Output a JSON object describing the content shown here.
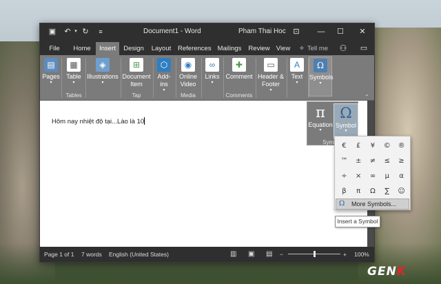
{
  "window": {
    "title": "Document1  -  Word",
    "user": "Pham Thai Hoc"
  },
  "tabs": [
    {
      "label": "File"
    },
    {
      "label": "Home"
    },
    {
      "label": "Insert"
    },
    {
      "label": "Design"
    },
    {
      "label": "Layout"
    },
    {
      "label": "References"
    },
    {
      "label": "Mailings"
    },
    {
      "label": "Review"
    },
    {
      "label": "View"
    },
    {
      "label": "Tell me"
    }
  ],
  "ribbon": {
    "pages": "Pages",
    "table": "Table",
    "illustrations": "Illustrations",
    "document_item_1": "Document",
    "document_item_2": "Item",
    "addins_1": "Add-",
    "addins_2": "ins",
    "online_video_1": "Online",
    "online_video_2": "Video",
    "links": "Links",
    "comment": "Comment",
    "header_footer_1": "Header &",
    "header_footer_2": "Footer",
    "text": "Text",
    "symbols": "Symbols",
    "groups": {
      "tables": "Tables",
      "tap": "Tap",
      "media": "Media",
      "comments": "Comments"
    }
  },
  "document": {
    "text": "Hôm nay nhiệt độ tại...Lào là 10"
  },
  "symbols_panel": {
    "equation": "Equation",
    "symbol": "Symbol",
    "group_label": "Symbols"
  },
  "symbol_grid": [
    "€",
    "£",
    "¥",
    "©",
    "®",
    "™",
    "±",
    "≠",
    "≤",
    "≥",
    "÷",
    "×",
    "∞",
    "µ",
    "α",
    "β",
    "π",
    "Ω",
    "∑",
    "☺"
  ],
  "more_symbols": "More Symbols...",
  "tooltip": "Insert a Symbol",
  "status": {
    "page": "Page 1 of 1",
    "words": "7 words",
    "language": "English (United States)",
    "zoom": "100%",
    "zoom_level": 1.0
  },
  "watermark": "GENK"
}
